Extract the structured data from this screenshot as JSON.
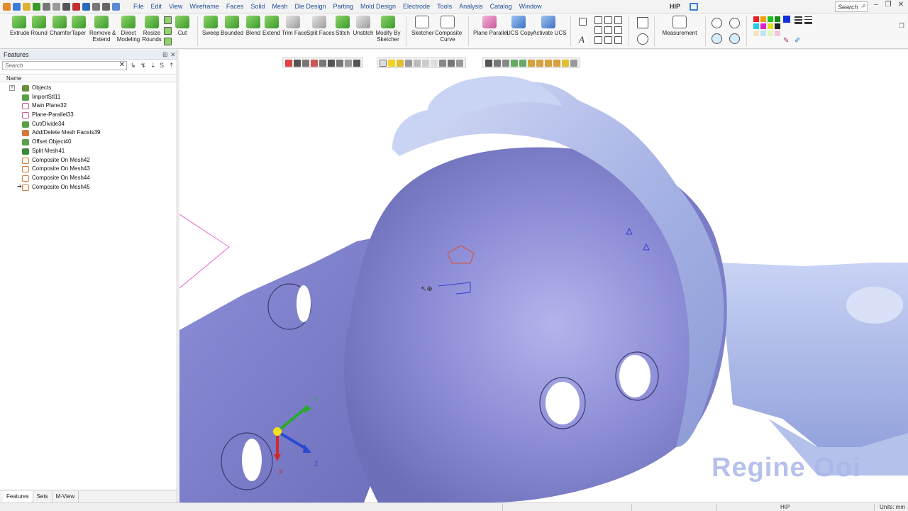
{
  "menubar": {
    "items": [
      "File",
      "Edit",
      "View",
      "Wireframe",
      "Faces",
      "Solid",
      "Mesh",
      "Die Design",
      "Parting",
      "Mold Design",
      "Electrode",
      "Tools",
      "Analysis",
      "Catalog",
      "Window"
    ],
    "app_title": "HIP",
    "search_placeholder": "Search"
  },
  "ribbon": {
    "buttons": [
      {
        "label": "Extrude",
        "icon": "extrude-icon"
      },
      {
        "label": "Round",
        "icon": "round-icon"
      },
      {
        "label": "Chamfer",
        "icon": "chamfer-icon"
      },
      {
        "label": "Taper",
        "icon": "taper-icon"
      },
      {
        "label": "Remove &",
        "label2": "Extend",
        "icon": "remove-extend-icon"
      },
      {
        "label": "Direct",
        "label2": "Modeling",
        "icon": "direct-modeling-icon"
      },
      {
        "label": "Resize",
        "label2": "Rounds",
        "icon": "resize-rounds-icon"
      },
      {
        "label": "Cut",
        "icon": "cut-icon"
      },
      {
        "label": "Sweep",
        "icon": "sweep-icon"
      },
      {
        "label": "Bounded",
        "icon": "bounded-icon"
      },
      {
        "label": "Blend",
        "icon": "blend-icon"
      },
      {
        "label": "Extend",
        "icon": "extend-icon"
      },
      {
        "label": "Trim Face",
        "icon": "trim-face-icon"
      },
      {
        "label": "Split Faces",
        "icon": "split-faces-icon"
      },
      {
        "label": "Stitch",
        "icon": "stitch-icon"
      },
      {
        "label": "Unstitch",
        "icon": "unstitch-icon"
      },
      {
        "label": "Modify By",
        "label2": "Sketcher",
        "icon": "modify-by-sketcher-icon"
      },
      {
        "label": "Sketcher",
        "icon": "sketcher-icon"
      },
      {
        "label": "Composite",
        "label2": "Curve",
        "icon": "composite-curve-icon"
      },
      {
        "label": "Plane Parallel",
        "icon": "plane-parallel-icon"
      },
      {
        "label": "UCS Copy",
        "icon": "ucs-copy-icon"
      },
      {
        "label": "Activate UCS",
        "icon": "activate-ucs-icon"
      },
      {
        "label": "Measurement",
        "icon": "measurement-icon"
      }
    ]
  },
  "features": {
    "panel_title": "Features",
    "search_placeholder": "Search",
    "column_name": "Name",
    "items": [
      {
        "label": "Objects",
        "icon": "objects-icon",
        "color": "#6a8f3a"
      },
      {
        "label": "ImportStl11",
        "icon": "import-stl-icon",
        "color": "#5aa04a"
      },
      {
        "label": "Main Plane32",
        "icon": "plane-icon",
        "color": "#c85a9a"
      },
      {
        "label": "Plane-Parallel33",
        "icon": "plane-parallel-icon",
        "color": "#c85a9a"
      },
      {
        "label": "Cut/Divide34",
        "icon": "cut-divide-icon",
        "color": "#5aa04a"
      },
      {
        "label": "Add/Delete Mesh Facets39",
        "icon": "mesh-facets-icon",
        "color": "#d07a3a"
      },
      {
        "label": "Offset Object40",
        "icon": "offset-object-icon",
        "color": "#5aa04a"
      },
      {
        "label": "Split Mesh41",
        "icon": "split-mesh-icon",
        "color": "#3a8a3a"
      },
      {
        "label": "Composite On Mesh42",
        "icon": "composite-mesh-icon",
        "color": "#d07a3a"
      },
      {
        "label": "Composite On Mesh43",
        "icon": "composite-mesh-icon",
        "color": "#d07a3a"
      },
      {
        "label": "Composite On Mesh44",
        "icon": "composite-mesh-icon",
        "color": "#d07a3a"
      },
      {
        "label": "Composite On Mesh45",
        "icon": "composite-mesh-icon",
        "color": "#d07a3a"
      }
    ],
    "tabs": [
      "Features",
      "Sets",
      "M-View"
    ]
  },
  "viewport": {
    "axis_labels": {
      "x": "X",
      "y": "Y",
      "z": "Z"
    },
    "watermark": "Regine Ooi"
  },
  "statusbar": {
    "mode": "HIP",
    "units": "Units: mm"
  }
}
